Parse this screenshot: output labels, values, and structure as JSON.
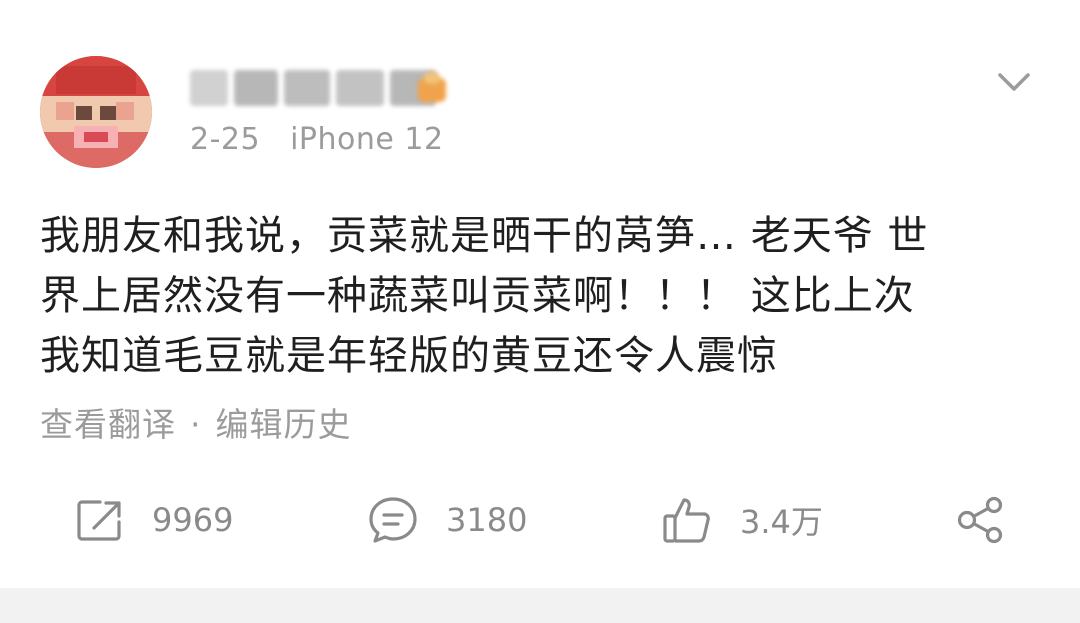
{
  "post": {
    "date": "2-25",
    "device": "iPhone 12",
    "content_lines": [
      "我朋友和我说，贡菜就是晒干的莴笋… 老天爷 世",
      "界上居然没有一种蔬菜叫贡菜啊！！！ 这比上次",
      "我知道毛豆就是年轻版的黄豆还令人震惊"
    ],
    "translate_label": "查看翻译",
    "separator": "·",
    "edit_history_label": "编辑历史"
  },
  "actions": {
    "repost_count": "9969",
    "comment_count": "3180",
    "like_count": "3.4万"
  },
  "icons": {
    "menu": "chevron-down-icon",
    "repost": "repost-icon",
    "comment": "comment-icon",
    "like": "thumbs-up-icon",
    "share": "share-icon"
  },
  "colors": {
    "text_primary": "#1f1f1f",
    "text_secondary": "#9b9b9b",
    "icon_gray": "#8a8a8a",
    "avatar_red": "#d9564e"
  }
}
